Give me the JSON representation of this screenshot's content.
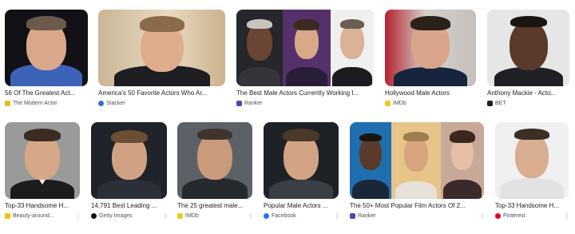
{
  "results": [
    {
      "caption": "56 Of The Greatest Act...",
      "source": "The Modern Actor",
      "icon": "modern-actor-logo-icon",
      "icon_color": "#e8b923"
    },
    {
      "caption": "America's 50 Favorite Actors Who Ar...",
      "source": "Stacker",
      "icon": "stacker-logo-icon",
      "icon_color": "#3a6fd8"
    },
    {
      "caption": "The Best Male Actors Currently Working I...",
      "source": "Ranker",
      "icon": "ranker-logo-icon",
      "icon_color": "#5b3fb0"
    },
    {
      "caption": "Hollywood Male Actors",
      "source": "IMDb",
      "icon": "imdb-logo-icon",
      "icon_color": "#f5c518"
    },
    {
      "caption": "Anthony Mackie - Acto...",
      "source": "BET",
      "icon": "bet-logo-icon",
      "icon_color": "#1f1f1f"
    },
    {
      "caption": "Top-33 Handsome H...",
      "source": "Beauty-around...",
      "icon": "beauty-around-logo-icon",
      "icon_color": "#f4c20d"
    },
    {
      "caption": "14,791 Best Leading ...",
      "source": "Getty Images",
      "icon": "getty-images-logo-icon",
      "icon_color": "#111111"
    },
    {
      "caption": "The 25 greatest male...",
      "source": "IMDb",
      "icon": "imdb-logo-icon",
      "icon_color": "#f5c518"
    },
    {
      "caption": "Popular Male Actors ...",
      "source": "Facebook",
      "icon": "facebook-logo-icon",
      "icon_color": "#1877f2"
    },
    {
      "caption": "The 50+ Most Popular Film Actors Of 2...",
      "source": "Ranker",
      "icon": "ranker-logo-icon",
      "icon_color": "#5b3fb0"
    },
    {
      "caption": "Top-33 Handsome H...",
      "source": "Pinterest",
      "icon": "pinterest-logo-icon",
      "icon_color": "#e60023"
    }
  ],
  "more_options_glyph": "⋮"
}
